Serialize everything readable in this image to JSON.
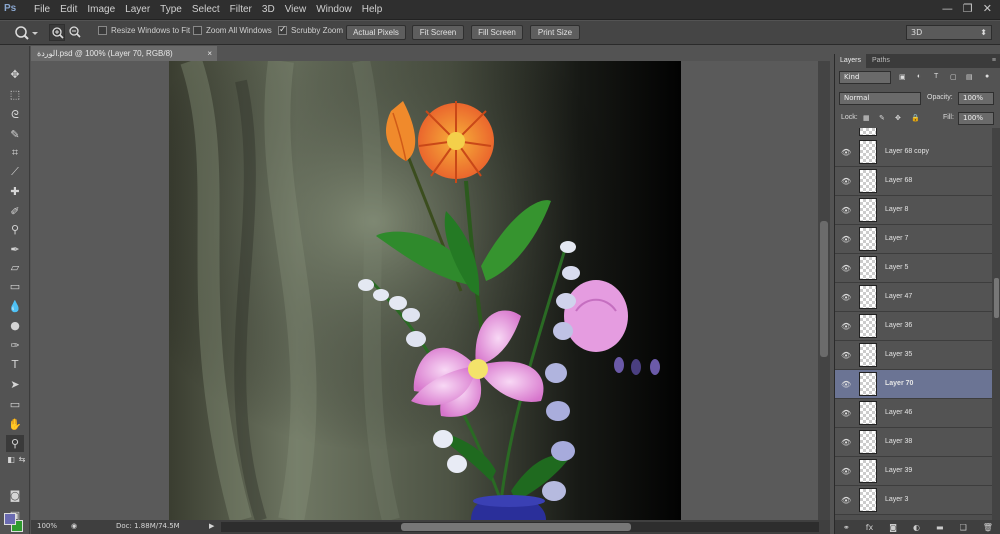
{
  "app": {
    "logo": "Ps"
  },
  "menu": [
    "File",
    "Edit",
    "Image",
    "Layer",
    "Type",
    "Select",
    "Filter",
    "3D",
    "View",
    "Window",
    "Help"
  ],
  "window_controls": {
    "minimize": "—",
    "restore": "❐",
    "close": "✕"
  },
  "options_bar": {
    "resize_windows": {
      "label": "Resize Windows to Fit",
      "checked": false
    },
    "zoom_all": {
      "label": "Zoom All Windows",
      "checked": false
    },
    "scrubby_zoom": {
      "label": "Scrubby Zoom",
      "checked": true
    },
    "buttons": [
      "Actual Pixels",
      "Fit Screen",
      "Fill Screen",
      "Print Size"
    ],
    "workspace": "3D"
  },
  "document": {
    "tab_title": "الوردة.psd @ 100% (Layer 70, RGB/8)"
  },
  "status": {
    "zoom": "100%",
    "doc_size": "Doc: 1.88M/74.5M"
  },
  "layers_panel": {
    "tabs": [
      "Layers",
      "Paths"
    ],
    "kind": "Kind",
    "blend_mode": "Normal",
    "opacity_label": "Opacity:",
    "opacity": "100%",
    "lock_label": "Lock:",
    "fill_label": "Fill:",
    "fill": "100%",
    "layers": [
      {
        "name": "Layer 68 copy",
        "selected": false
      },
      {
        "name": "Layer 68",
        "selected": false
      },
      {
        "name": "Layer 8",
        "selected": false
      },
      {
        "name": "Layer 7",
        "selected": false
      },
      {
        "name": "Layer 5",
        "selected": false
      },
      {
        "name": "Layer 47",
        "selected": false
      },
      {
        "name": "Layer 36",
        "selected": false
      },
      {
        "name": "Layer 35",
        "selected": false
      },
      {
        "name": "Layer 70",
        "selected": true
      },
      {
        "name": "Layer 46",
        "selected": false
      },
      {
        "name": "Layer 38",
        "selected": false
      },
      {
        "name": "Layer 39",
        "selected": false
      },
      {
        "name": "Layer 3",
        "selected": false
      }
    ],
    "footer_icons": [
      "link-icon",
      "fx-icon",
      "mask-icon",
      "adjustment-icon",
      "folder-icon",
      "new-layer-icon",
      "trash-icon"
    ]
  },
  "colors": {
    "foreground": "#6b6bb1",
    "background": "#2f9b2f",
    "selected_layer": "#6b7494"
  }
}
